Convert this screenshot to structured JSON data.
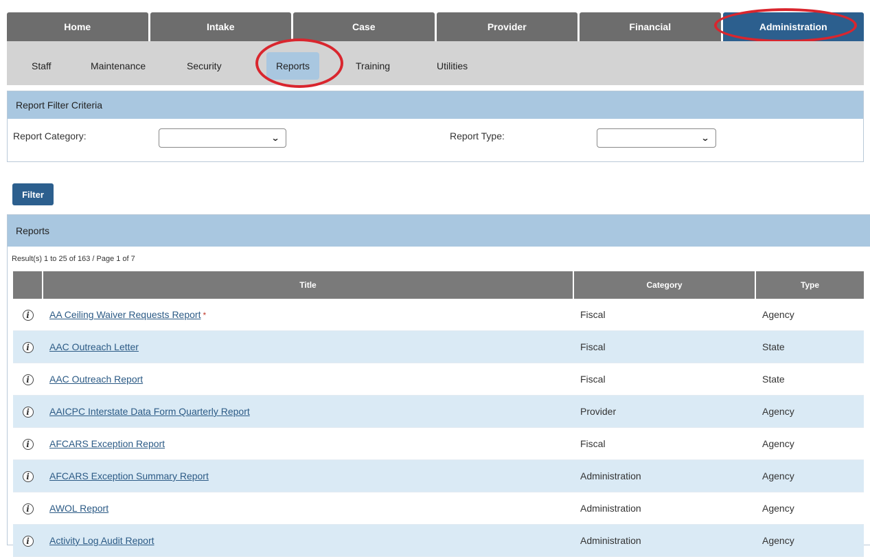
{
  "top_nav": {
    "tabs": [
      {
        "label": "Home",
        "active": false
      },
      {
        "label": "Intake",
        "active": false
      },
      {
        "label": "Case",
        "active": false
      },
      {
        "label": "Provider",
        "active": false
      },
      {
        "label": "Financial",
        "active": false
      },
      {
        "label": "Administration",
        "active": true
      }
    ]
  },
  "sub_nav": {
    "items": [
      {
        "label": "Staff"
      },
      {
        "label": "Maintenance"
      },
      {
        "label": "Security"
      },
      {
        "label": "Reports",
        "active": true
      },
      {
        "label": "Training"
      },
      {
        "label": "Utilities"
      }
    ]
  },
  "filter": {
    "header": "Report Filter Criteria",
    "category_label": "Report Category:",
    "category_value": "",
    "type_label": "Report Type:",
    "type_value": "",
    "button": "Filter"
  },
  "reports": {
    "header": "Reports",
    "results_text": "Result(s) 1 to 25 of 163 / Page 1 of 7",
    "columns": {
      "title": "Title",
      "category": "Category",
      "type": "Type"
    },
    "rows": [
      {
        "title": "AA Ceiling Waiver Requests Report",
        "required_mark": "*",
        "category": "Fiscal",
        "type": "Agency"
      },
      {
        "title": "AAC Outreach Letter",
        "required_mark": "",
        "category": "Fiscal",
        "type": "State"
      },
      {
        "title": "AAC Outreach Report",
        "required_mark": "",
        "category": "Fiscal",
        "type": "State"
      },
      {
        "title": "AAICPC Interstate Data Form Quarterly Report",
        "required_mark": "",
        "category": "Provider",
        "type": "Agency"
      },
      {
        "title": "AFCARS Exception Report",
        "required_mark": "",
        "category": "Fiscal",
        "type": "Agency"
      },
      {
        "title": "AFCARS Exception Summary Report",
        "required_mark": "",
        "category": "Administration",
        "type": "Agency"
      },
      {
        "title": "AWOL Report",
        "required_mark": "",
        "category": "Administration",
        "type": "Agency"
      },
      {
        "title": "Activity Log Audit Report",
        "required_mark": "",
        "category": "Administration",
        "type": "Agency"
      }
    ]
  },
  "colors": {
    "tab_bg": "#6d6d6d",
    "tab_active_bg": "#2c5f8e",
    "subnav_bg": "#d3d3d3",
    "panel_header_bg": "#a9c7e0",
    "row_alt_bg": "#daeaf5",
    "link": "#2b5a85",
    "highlight_circle": "#d9262e"
  },
  "icons": {
    "row_info": "info-icon",
    "select_chevron": "chevron-down-icon"
  }
}
